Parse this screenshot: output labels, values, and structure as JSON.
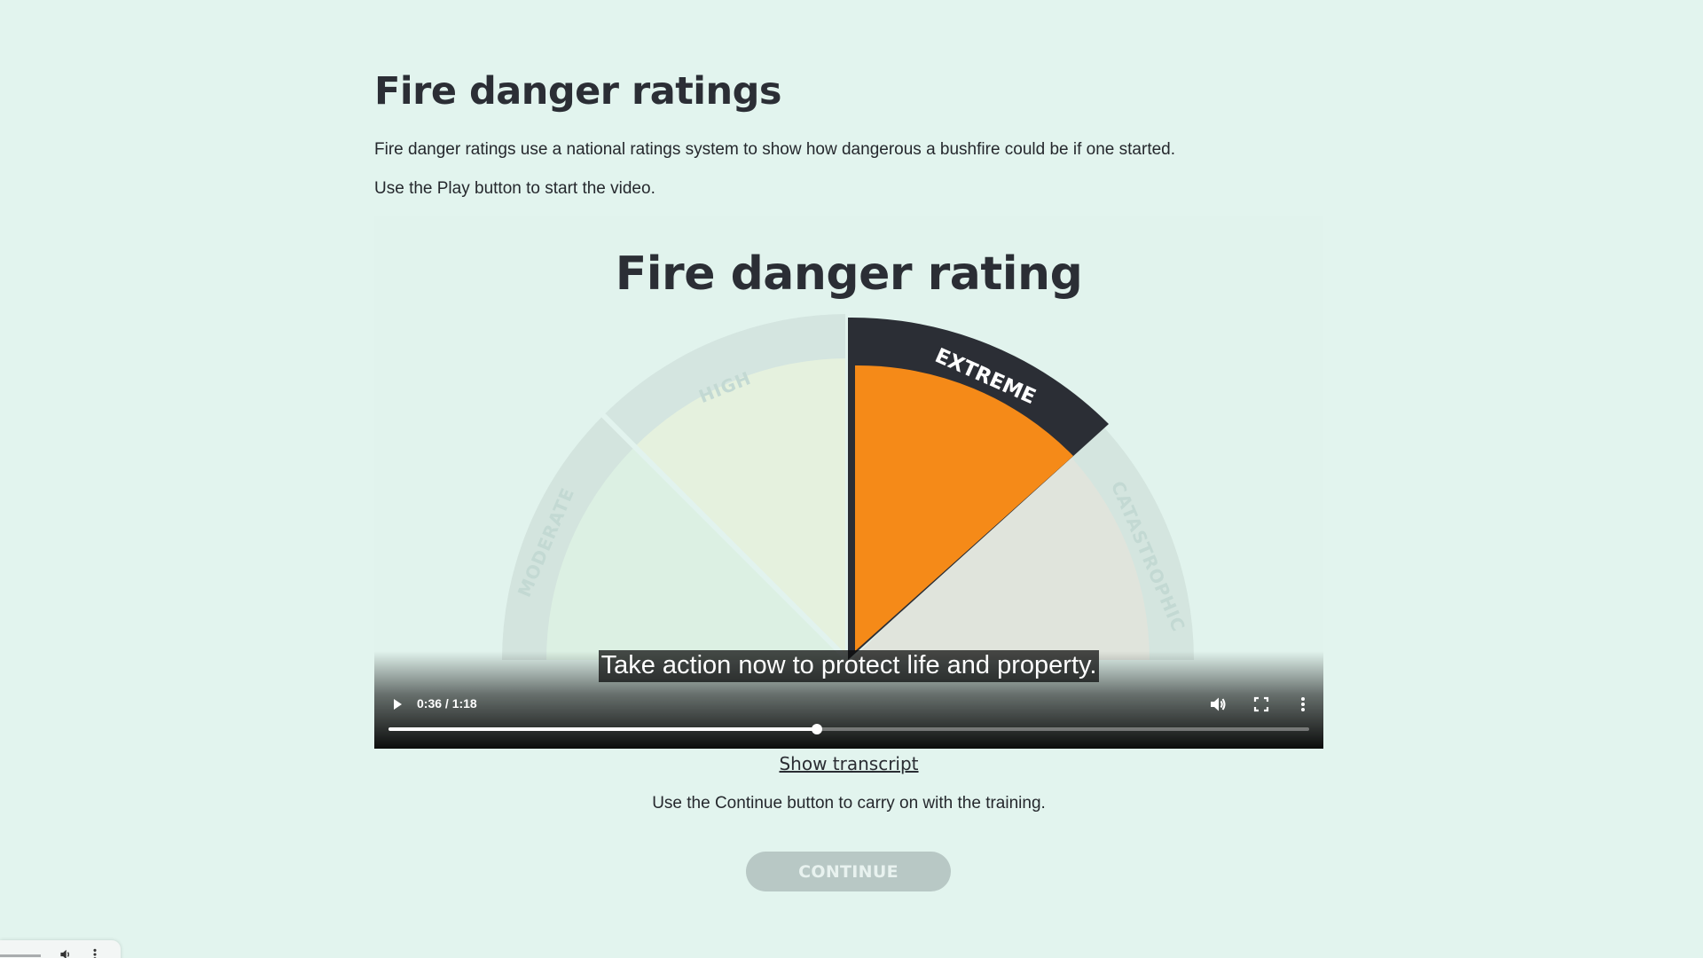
{
  "page": {
    "title": "Fire danger ratings",
    "intro": "Fire danger ratings use a national ratings system to show how dangerous a bushfire could be if one started.",
    "instruction": "Use the Play button to start the video."
  },
  "video": {
    "heading": "Fire danger rating",
    "segments": {
      "moderate": "MODERATE",
      "high": "HIGH",
      "extreme": "EXTREME",
      "catastrophic": "CATASTROPHIC"
    },
    "caption": "Take action now to protect life and property.",
    "time_display": "0:36 / 1:18",
    "progress": 0.465,
    "icons": {
      "play": "play-icon",
      "volume": "volume-icon",
      "fullscreen": "fullscreen-icon",
      "menu": "more-vert-icon"
    },
    "colors": {
      "extreme_fill": "#f58a18",
      "extreme_band": "#2b2e35"
    }
  },
  "transcript_link": "Show transcript",
  "continue_text": "Use the Continue button to carry on with the training.",
  "continue_label": "CONTINUE"
}
